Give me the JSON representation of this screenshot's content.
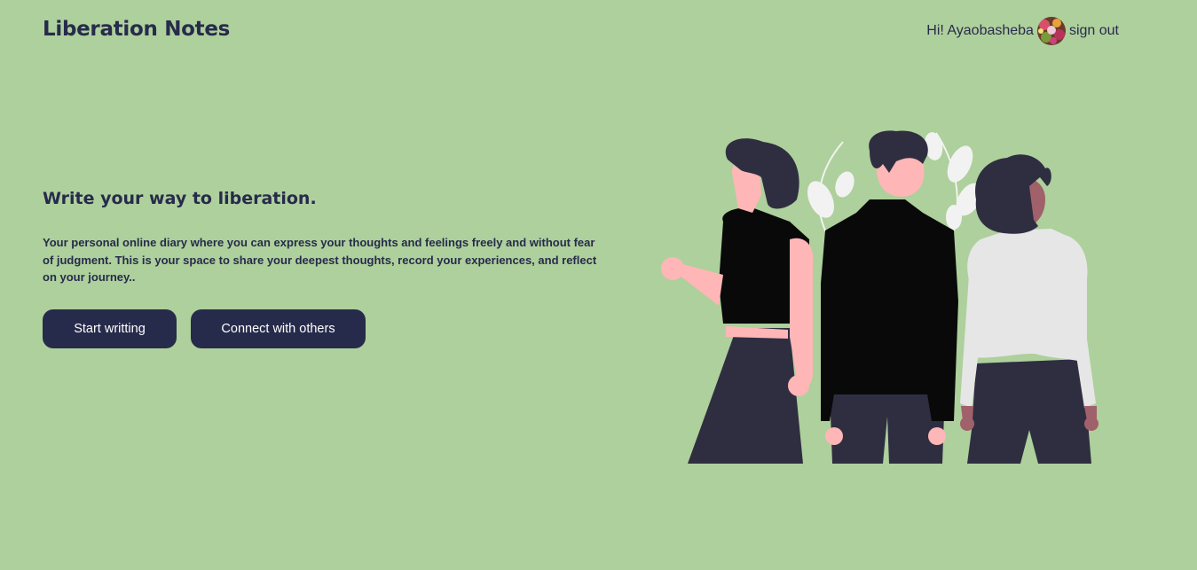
{
  "header": {
    "brand": "Liberation Notes",
    "greeting": "Hi! Ayaobasheba",
    "avatar_icon": "user-avatar-icon",
    "signout_label": "sign out"
  },
  "hero": {
    "title": "Write your way to liberation.",
    "description": "Your personal online diary where you can express your thoughts and feelings freely and without fear of judgment. This is your space to share your deepest thoughts, record your experiences, and reflect on your journey..",
    "buttons": {
      "start_label": "Start writting",
      "connect_label": "Connect with others"
    }
  },
  "colors": {
    "background": "#aed09c",
    "primary": "#272b4b",
    "button_text": "#ffffff"
  }
}
